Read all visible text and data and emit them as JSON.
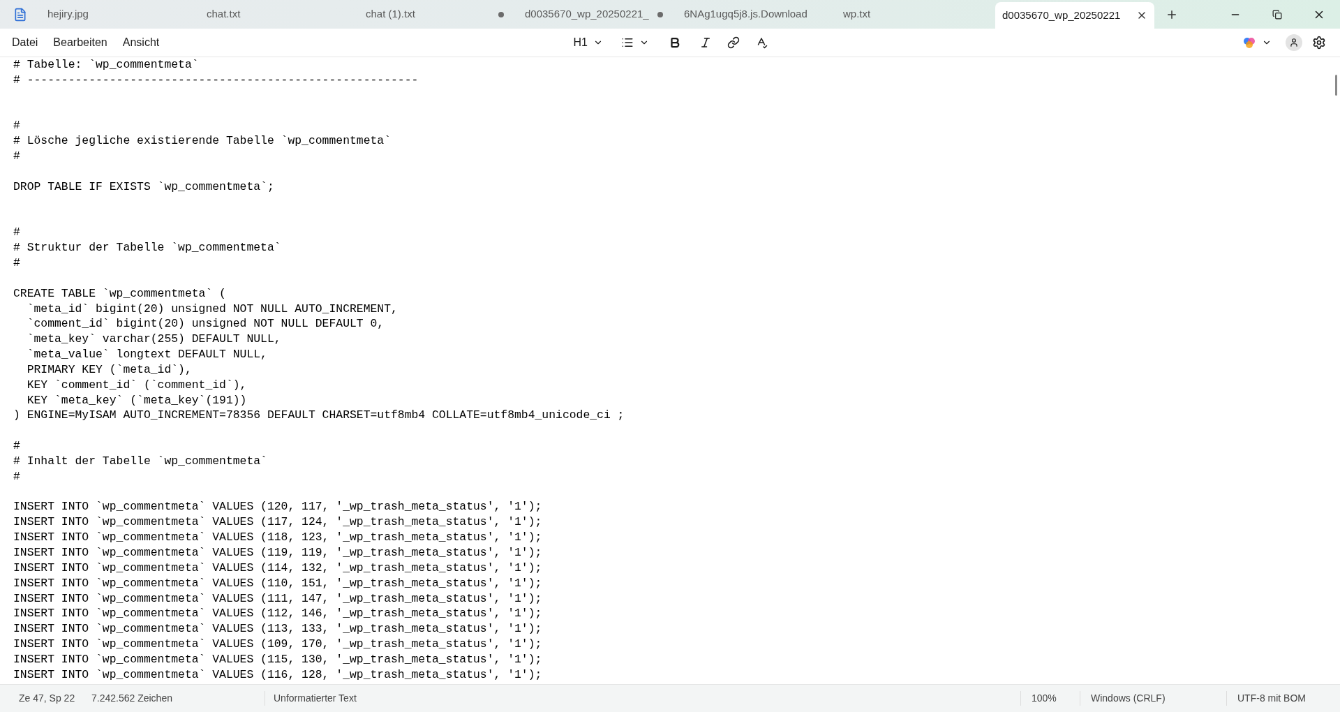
{
  "tabs": [
    {
      "label": "hejiry.jpg",
      "selected": false,
      "modified": false
    },
    {
      "label": "chat.txt",
      "selected": false,
      "modified": false
    },
    {
      "label": "chat (1).txt",
      "selected": false,
      "modified": true
    },
    {
      "label": "d0035670_wp_20250221_",
      "selected": false,
      "modified": true
    },
    {
      "label": "6NAg1ugq5j8.js.Download",
      "selected": false,
      "modified": false
    },
    {
      "label": "wp.txt",
      "selected": false,
      "modified": false
    },
    {
      "label": "d0035670_wp_20250221",
      "selected": true,
      "modified": false
    }
  ],
  "menu": [
    "Datei",
    "Bearbeiten",
    "Ansicht"
  ],
  "toolbar": {
    "heading": "H1"
  },
  "lines": [
    {
      "kind": "text",
      "text": "# Tabelle: `wp_commentmeta`"
    },
    {
      "kind": "text",
      "text": "# ---------------------------------------------------------"
    },
    {
      "kind": "blank"
    },
    {
      "kind": "blank"
    },
    {
      "kind": "text",
      "text": "#"
    },
    {
      "kind": "text",
      "text": "# Lösche jegliche existierende Tabelle `wp_commentmeta`"
    },
    {
      "kind": "text",
      "text": "#"
    },
    {
      "kind": "blank"
    },
    {
      "kind": "text",
      "text": "DROP TABLE IF EXISTS `wp_commentmeta`;"
    },
    {
      "kind": "blank"
    },
    {
      "kind": "blank"
    },
    {
      "kind": "text",
      "text": "#"
    },
    {
      "kind": "text",
      "text": "# Struktur der Tabelle `wp_commentmeta`"
    },
    {
      "kind": "text",
      "text": "#"
    },
    {
      "kind": "blank"
    },
    {
      "kind": "text",
      "text": "CREATE TABLE `wp_commentmeta` ("
    },
    {
      "kind": "text",
      "text": "  `meta_id` bigint(20) unsigned NOT NULL AUTO_INCREMENT,"
    },
    {
      "kind": "text",
      "text": "  `comment_id` bigint(20) unsigned NOT NULL DEFAULT 0,"
    },
    {
      "kind": "text",
      "text": "  `meta_key` varchar(255) DEFAULT NULL,"
    },
    {
      "kind": "text",
      "text": "  `meta_value` longtext DEFAULT NULL,"
    },
    {
      "kind": "text",
      "text": "  PRIMARY KEY (`meta_id`),"
    },
    {
      "kind": "text",
      "text": "  KEY `comment_id` (`comment_id`),"
    },
    {
      "kind": "text",
      "text": "  KEY `meta_key` (`meta_key`(191))"
    },
    {
      "kind": "text",
      "text": ") ENGINE=MyISAM AUTO_INCREMENT=78356 DEFAULT CHARSET=utf8mb4 COLLATE=utf8mb4_unicode_ci ;"
    },
    {
      "kind": "blank"
    },
    {
      "kind": "text",
      "text": "#"
    },
    {
      "kind": "text",
      "text": "# Inhalt der Tabelle `wp_commentmeta`"
    },
    {
      "kind": "text",
      "text": "#"
    },
    {
      "kind": "blank"
    },
    {
      "kind": "text",
      "text": "INSERT INTO `wp_commentmeta` VALUES (120, 117, '_wp_trash_meta_status', '1');"
    },
    {
      "kind": "text",
      "text": "INSERT INTO `wp_commentmeta` VALUES (117, 124, '_wp_trash_meta_status', '1');"
    },
    {
      "kind": "text",
      "text": "INSERT INTO `wp_commentmeta` VALUES (118, 123, '_wp_trash_meta_status', '1');"
    },
    {
      "kind": "text",
      "text": "INSERT INTO `wp_commentmeta` VALUES (119, 119, '_wp_trash_meta_status', '1');"
    },
    {
      "kind": "text",
      "text": "INSERT INTO `wp_commentmeta` VALUES (114, 132, '_wp_trash_meta_status', '1');"
    },
    {
      "kind": "text",
      "text": "INSERT INTO `wp_commentmeta` VALUES (110, 151, '_wp_trash_meta_status', '1');"
    },
    {
      "kind": "text",
      "text": "INSERT INTO `wp_commentmeta` VALUES (111, 147, '_wp_trash_meta_status', '1');"
    },
    {
      "kind": "text",
      "text": "INSERT INTO `wp_commentmeta` VALUES (112, 146, '_wp_trash_meta_status', '1');"
    },
    {
      "kind": "text",
      "text": "INSERT INTO `wp_commentmeta` VALUES (113, 133, '_wp_trash_meta_status', '1');"
    },
    {
      "kind": "text",
      "text": "INSERT INTO `wp_commentmeta` VALUES (109, 170, '_wp_trash_meta_status', '1');"
    },
    {
      "kind": "text",
      "text": "INSERT INTO `wp_commentmeta` VALUES (115, 130, '_wp_trash_meta_status', '1');"
    },
    {
      "kind": "text",
      "text": "INSERT INTO `wp_commentmeta` VALUES (116, 128, '_wp_trash_meta_status', '1');"
    }
  ],
  "status_bar": {
    "position": "Ze 47, Sp 22",
    "characters": "7.242.562 Zeichen",
    "format": "Unformatierter Text",
    "zoom": "100%",
    "line_ending": "Windows (CRLF)",
    "encoding": "UTF-8 mit BOM"
  }
}
